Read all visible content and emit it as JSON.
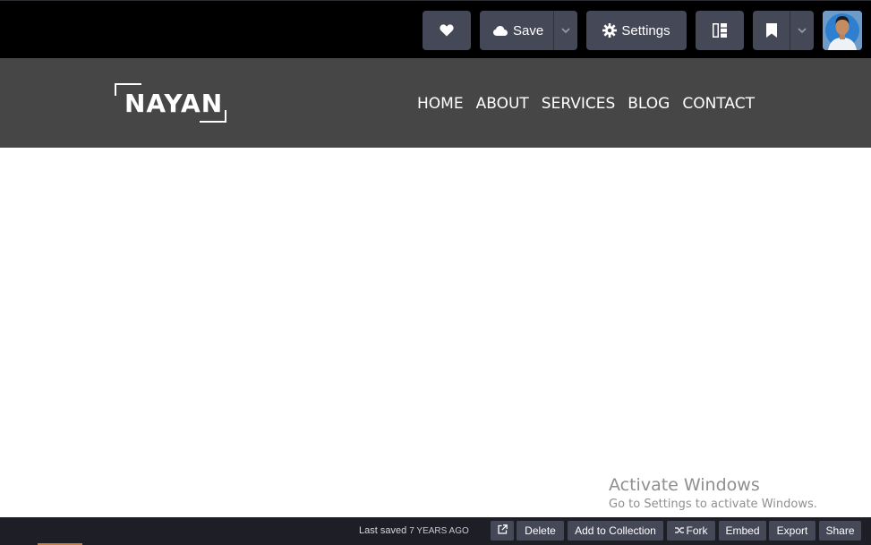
{
  "editor_toolbar": {
    "save_label": "Save",
    "settings_label": "Settings",
    "icons": {
      "heart": "heart-icon",
      "cloud": "cloud-icon",
      "gear": "gear-icon",
      "layout": "layout-icon",
      "bookmark": "bookmark-icon",
      "chevron": "chevron-down-icon"
    }
  },
  "site": {
    "logo": "NAYAN",
    "nav": [
      "HOME",
      "ABOUT",
      "SERVICES",
      "BLOG",
      "CONTACT"
    ]
  },
  "watermark": {
    "title": "Activate Windows",
    "subtitle": "Go to Settings to activate Windows."
  },
  "footer": {
    "last_saved_prefix": "Last saved",
    "last_saved_when": "7 YEARS AGO",
    "delete": "Delete",
    "add_to_collection": "Add to Collection",
    "fork": "Fork",
    "embed": "Embed",
    "export": "Export",
    "share": "Share"
  },
  "colors": {
    "toolbar_bg": "#000000",
    "button_bg": "#444857",
    "header_bg": "#464646",
    "footer_bg": "#1e1f26"
  }
}
